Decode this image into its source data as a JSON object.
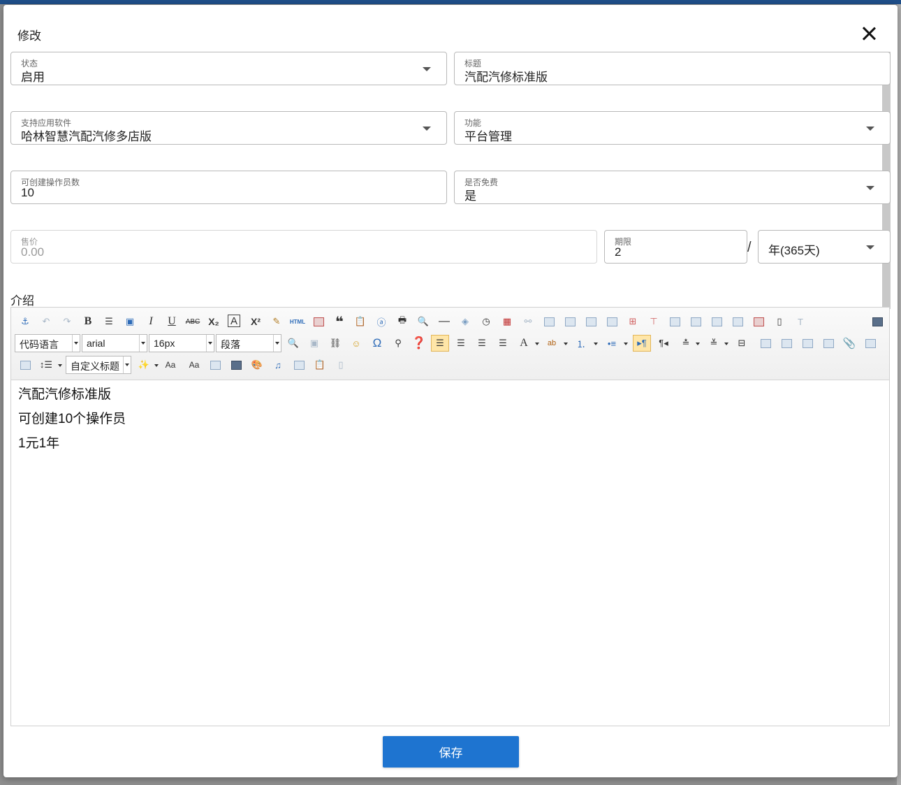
{
  "dialog": {
    "title": "修改",
    "close_icon": "close-icon"
  },
  "form": {
    "status": {
      "label": "状态",
      "value": "启用"
    },
    "title": {
      "label": "标题",
      "value": "汽配汽修标准版"
    },
    "software": {
      "label": "支持应用软件",
      "value": "哈林智慧汽配汽修多店版"
    },
    "function": {
      "label": "功能",
      "value": "平台管理"
    },
    "operators": {
      "label": "可创建操作员数",
      "value": "10"
    },
    "is_free": {
      "label": "是否免费",
      "value": "是"
    },
    "price": {
      "label": "售价",
      "value": "0.00"
    },
    "period": {
      "label": "期限",
      "value": "2"
    },
    "separator": "/",
    "unit": {
      "value": "年(365天)"
    }
  },
  "intro": {
    "label": "介绍",
    "toolbar": {
      "code_language": "代码语言",
      "font_family": "arial",
      "font_size": "16px",
      "paragraph": "段落",
      "custom_heading": "自定义标题"
    },
    "content": [
      "汽配汽修标准版",
      "可创建10个操作员",
      "1元1年"
    ]
  },
  "actions": {
    "save_label": "保存"
  },
  "colors": {
    "primary": "#1e74d0",
    "topbar": "#1f4f8a"
  }
}
